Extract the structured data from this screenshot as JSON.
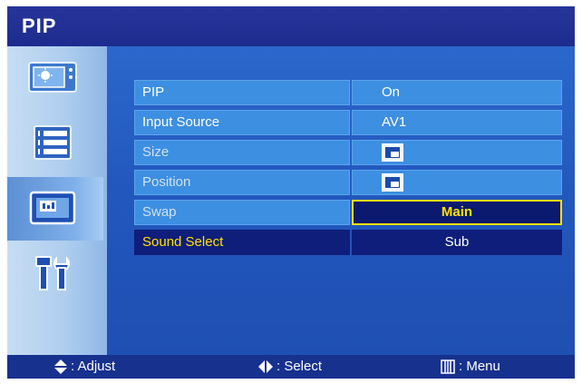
{
  "window": {
    "title": "PIP"
  },
  "sidebar": {
    "items": [
      {
        "icon": "picture-icon",
        "selected": false
      },
      {
        "icon": "list-icon",
        "selected": false
      },
      {
        "icon": "pip-icon",
        "selected": true
      },
      {
        "icon": "tools-icon",
        "selected": false
      }
    ]
  },
  "menu": {
    "rows": [
      {
        "label": "PIP",
        "value": "On"
      },
      {
        "label": "Input Source",
        "value": "AV1"
      },
      {
        "label": "Size",
        "value_icon": "pip-size-icon"
      },
      {
        "label": "Position",
        "value_icon": "pip-position-icon"
      },
      {
        "label": "Swap",
        "value": "Main"
      },
      {
        "label": "Sound Select",
        "value": "Sub"
      }
    ]
  },
  "footer": {
    "adjust_label": ": Adjust",
    "select_label": ": Select",
    "menu_label": ": Menu"
  },
  "colors": {
    "background": "#1b2f92",
    "row": "#3d8fe2",
    "highlight_text": "#ffe100",
    "highlight_bg": "#0f1e7a"
  }
}
